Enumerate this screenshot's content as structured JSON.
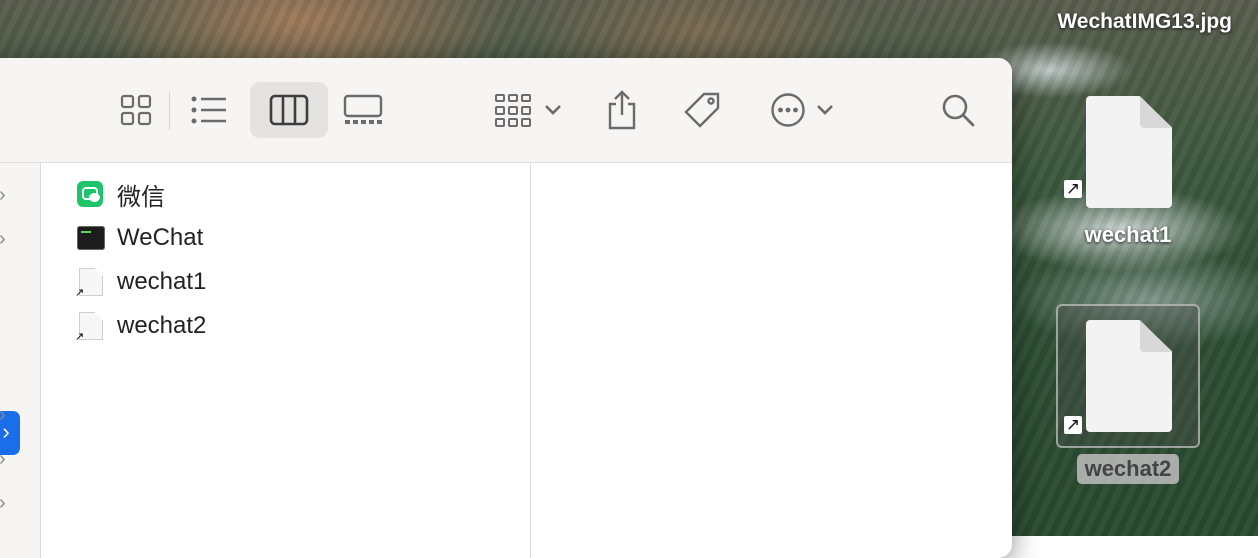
{
  "desktop": {
    "wallpaper_file_label": "WechatIMG13.jpg",
    "icons": [
      {
        "label": "wechat1",
        "icon": "alias-document-icon",
        "selected": false
      },
      {
        "label": "wechat2",
        "icon": "alias-document-icon",
        "selected": true
      }
    ]
  },
  "finder": {
    "toolbar": {
      "view_buttons": [
        {
          "name": "icon-view",
          "icon": "grid-icon",
          "active": false
        },
        {
          "name": "list-view",
          "icon": "list-icon",
          "active": false
        },
        {
          "name": "column-view",
          "icon": "columns-icon",
          "active": true
        },
        {
          "name": "gallery-view",
          "icon": "gallery-icon",
          "active": false
        }
      ],
      "actions": [
        "group-by",
        "share",
        "tags",
        "more",
        "search"
      ]
    },
    "sidebar_chevrons": 6,
    "column1": {
      "items": [
        {
          "name": "微信",
          "icon": "wechat-app-icon"
        },
        {
          "name": "WeChat",
          "icon": "terminal-exec-icon"
        },
        {
          "name": "wechat1",
          "icon": "alias-document-icon"
        },
        {
          "name": "wechat2",
          "icon": "alias-document-icon"
        }
      ]
    }
  }
}
